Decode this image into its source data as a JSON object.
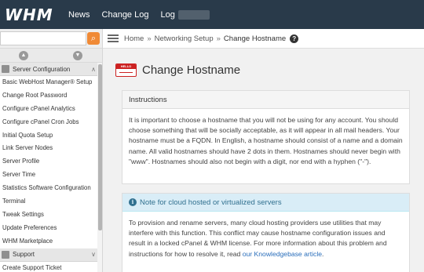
{
  "app": {
    "logo": "WHM"
  },
  "topnav": {
    "items": [
      "News",
      "Change Log",
      "Log"
    ]
  },
  "sidebar": {
    "search": {
      "value": "",
      "placeholder": ""
    },
    "section": "Server Configuration",
    "items": [
      "Basic WebHost Manager® Setup",
      "Change Root Password",
      "Configure cPanel Analytics",
      "Configure cPanel Cron Jobs",
      "Initial Quota Setup",
      "Link Server Nodes",
      "Server Profile",
      "Server Time",
      "Statistics Software Configuration",
      "Terminal",
      "Tweak Settings",
      "Update Preferences",
      "WHM Marketplace"
    ],
    "section2": "Support",
    "next_item": "Create Support Ticket"
  },
  "breadcrumb": {
    "home": "Home",
    "sep": "»",
    "parent": "Networking Setup",
    "current": "Change Hostname"
  },
  "page": {
    "title": "Change Hostname",
    "hello_label": "HELLO"
  },
  "instructions": {
    "heading": "Instructions",
    "text": "It is important to choose a hostname that you will not be using for any account. You should choose something that will be socially acceptable, as it will appear in all mail headers. Your hostname must be a FQDN. In English, a hostname should consist of a name and a domain name. All valid hostnames should have 2 dots in them. Hostnames should never begin with \"www\". Hostnames should also not begin with a digit, nor end with a hyphen (\"-\")."
  },
  "note": {
    "heading": "Note for cloud hosted or virtualized servers",
    "text": "To provision and rename servers, many cloud hosting providers use utilities that may interfere with this function. This conflict may cause hostname configuration issues and result in a locked cPanel & WHM license. For more information about this problem and instructions for how to resolve it, read",
    "link": "our Knowledgebase article",
    "end": "."
  },
  "colors": {
    "header": "#293a4a",
    "accent": "#f08a36",
    "link": "#2a6ebb",
    "info_bg": "#d9edf7"
  }
}
